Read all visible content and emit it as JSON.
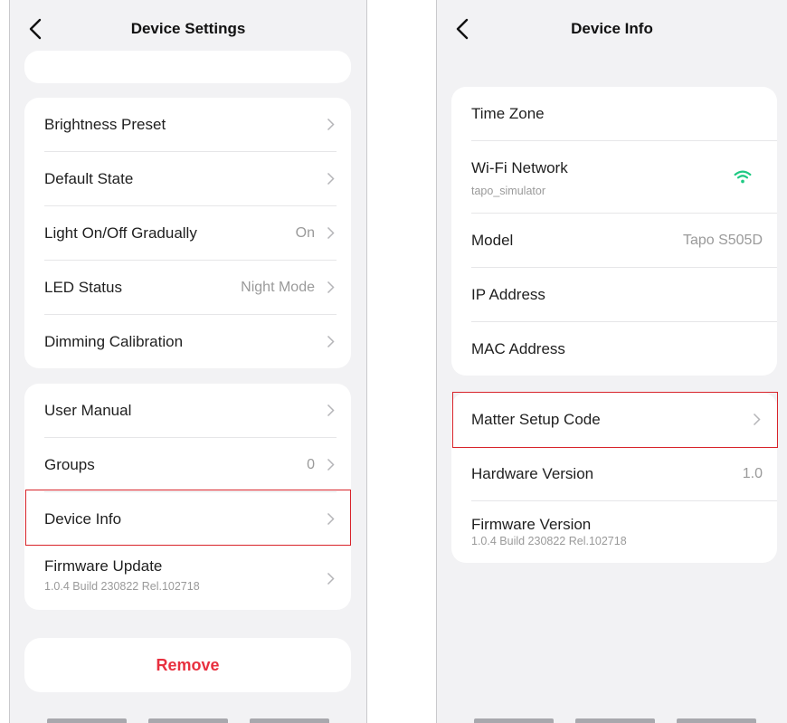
{
  "left": {
    "title": "Device Settings",
    "group1": [
      {
        "label": "Brightness Preset",
        "value": ""
      },
      {
        "label": "Default State",
        "value": ""
      },
      {
        "label": "Light On/Off Gradually",
        "value": "On"
      },
      {
        "label": "LED Status",
        "value": "Night Mode"
      },
      {
        "label": "Dimming Calibration",
        "value": ""
      }
    ],
    "group2": [
      {
        "label": "User Manual",
        "value": ""
      },
      {
        "label": "Groups",
        "value": "0"
      },
      {
        "label": "Device Info",
        "value": ""
      },
      {
        "label": "Firmware Update",
        "sub": "1.0.4 Build 230822 Rel.102718"
      }
    ],
    "remove_label": "Remove"
  },
  "right": {
    "title": "Device Info",
    "group1": [
      {
        "label": "Time Zone"
      },
      {
        "label": "Wi-Fi Network",
        "sub": "tapo_simulator",
        "icon": "wifi-icon"
      },
      {
        "label": "Model",
        "value": "Tapo S505D"
      },
      {
        "label": "IP Address"
      },
      {
        "label": "MAC Address"
      }
    ],
    "group2": [
      {
        "label": "Matter Setup Code"
      },
      {
        "label": "Hardware Version",
        "value": "1.0"
      },
      {
        "label": "Firmware Version",
        "sub": "1.0.4 Build 230822 Rel.102718"
      }
    ]
  },
  "colors": {
    "background": "#f2f2f4",
    "card": "#ffffff",
    "highlight": "#d8232a",
    "remove": "#e8303f",
    "wifi": "#1fc983",
    "secondary_text": "#9a9a9a"
  }
}
